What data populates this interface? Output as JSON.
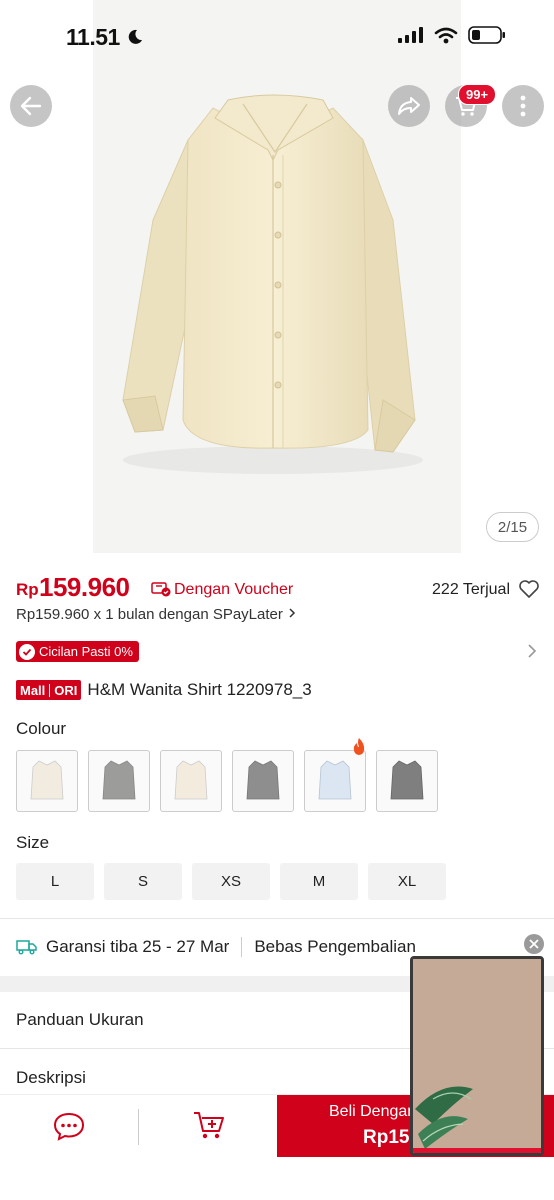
{
  "status_bar": {
    "time": "11.51"
  },
  "gallery": {
    "counter": "2/15"
  },
  "header": {
    "cart_badge": "99+"
  },
  "price": {
    "currency": "Rp",
    "amount": "159.960",
    "voucher_text": "Dengan Voucher",
    "sold": "222 Terjual",
    "paylater": "Rp159.960 x 1 bulan dengan SPayLater"
  },
  "promo": {
    "cicilan": "Cicilan Pasti 0%"
  },
  "product": {
    "mall_label": "Mall",
    "ori_label": "ORI",
    "title": "H&M Wanita Shirt 1220978_3"
  },
  "colour": {
    "label": "Colour",
    "swatches": [
      {
        "name": "cream",
        "color": "#f1ecdf"
      },
      {
        "name": "grey",
        "color": "#9c9c9a"
      },
      {
        "name": "beige",
        "color": "#f3ecde"
      },
      {
        "name": "dark-grey",
        "color": "#8e8e8e"
      },
      {
        "name": "light-blue",
        "color": "#dbe6f2"
      },
      {
        "name": "charcoal",
        "color": "#7f7f80"
      }
    ]
  },
  "size": {
    "label": "Size",
    "options": [
      "L",
      "S",
      "XS",
      "M",
      "XL"
    ]
  },
  "shipping": {
    "guarantee": "Garansi tiba 25 - 27 Mar",
    "returns": "Bebas Pengembalian"
  },
  "sections": {
    "size_guide": "Panduan Ukuran",
    "description": "Deskripsi"
  },
  "bottom_bar": {
    "buy_line1": "Beli Dengan Voucher",
    "buy_line2": "Rp159.960"
  },
  "colors": {
    "accent": "#d0011b"
  }
}
